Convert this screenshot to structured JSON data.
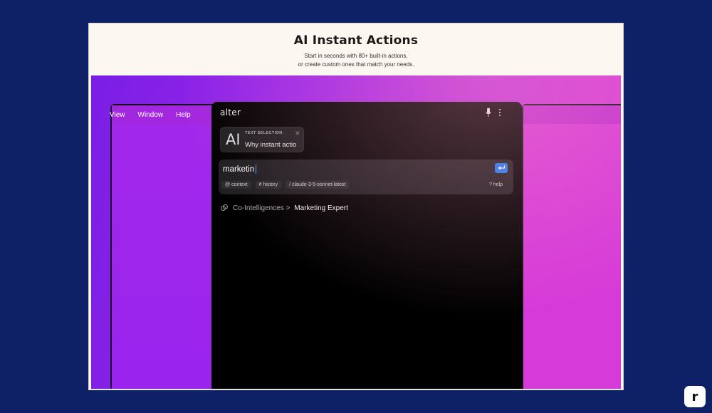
{
  "hero": {
    "title": "AI Instant Actions",
    "subtitle_line1": "Start in seconds with 80+ built-in actions,",
    "subtitle_line2": "or create custom ones that match your needs."
  },
  "mac_menu": {
    "items": [
      "View",
      "Window",
      "Help"
    ]
  },
  "alter": {
    "logo": "alter",
    "selection_chip": {
      "glyph": "AI",
      "caption": "TEXT SELECTION",
      "text": "Why instant actions"
    },
    "prompt": {
      "value": "marketin",
      "tags": [
        "@ context",
        "# history",
        "/ claude-3-5-sonnet-latest"
      ],
      "help": "? help"
    },
    "suggestion": {
      "path": "Co-Intelligences >",
      "target": "Marketing Expert"
    }
  },
  "brand_badge": "r",
  "colors": {
    "page_bg": "#0f2166",
    "accent_blue": "#1f7af0",
    "purple": "#9a24ee",
    "magenta": "#d63ad8"
  }
}
